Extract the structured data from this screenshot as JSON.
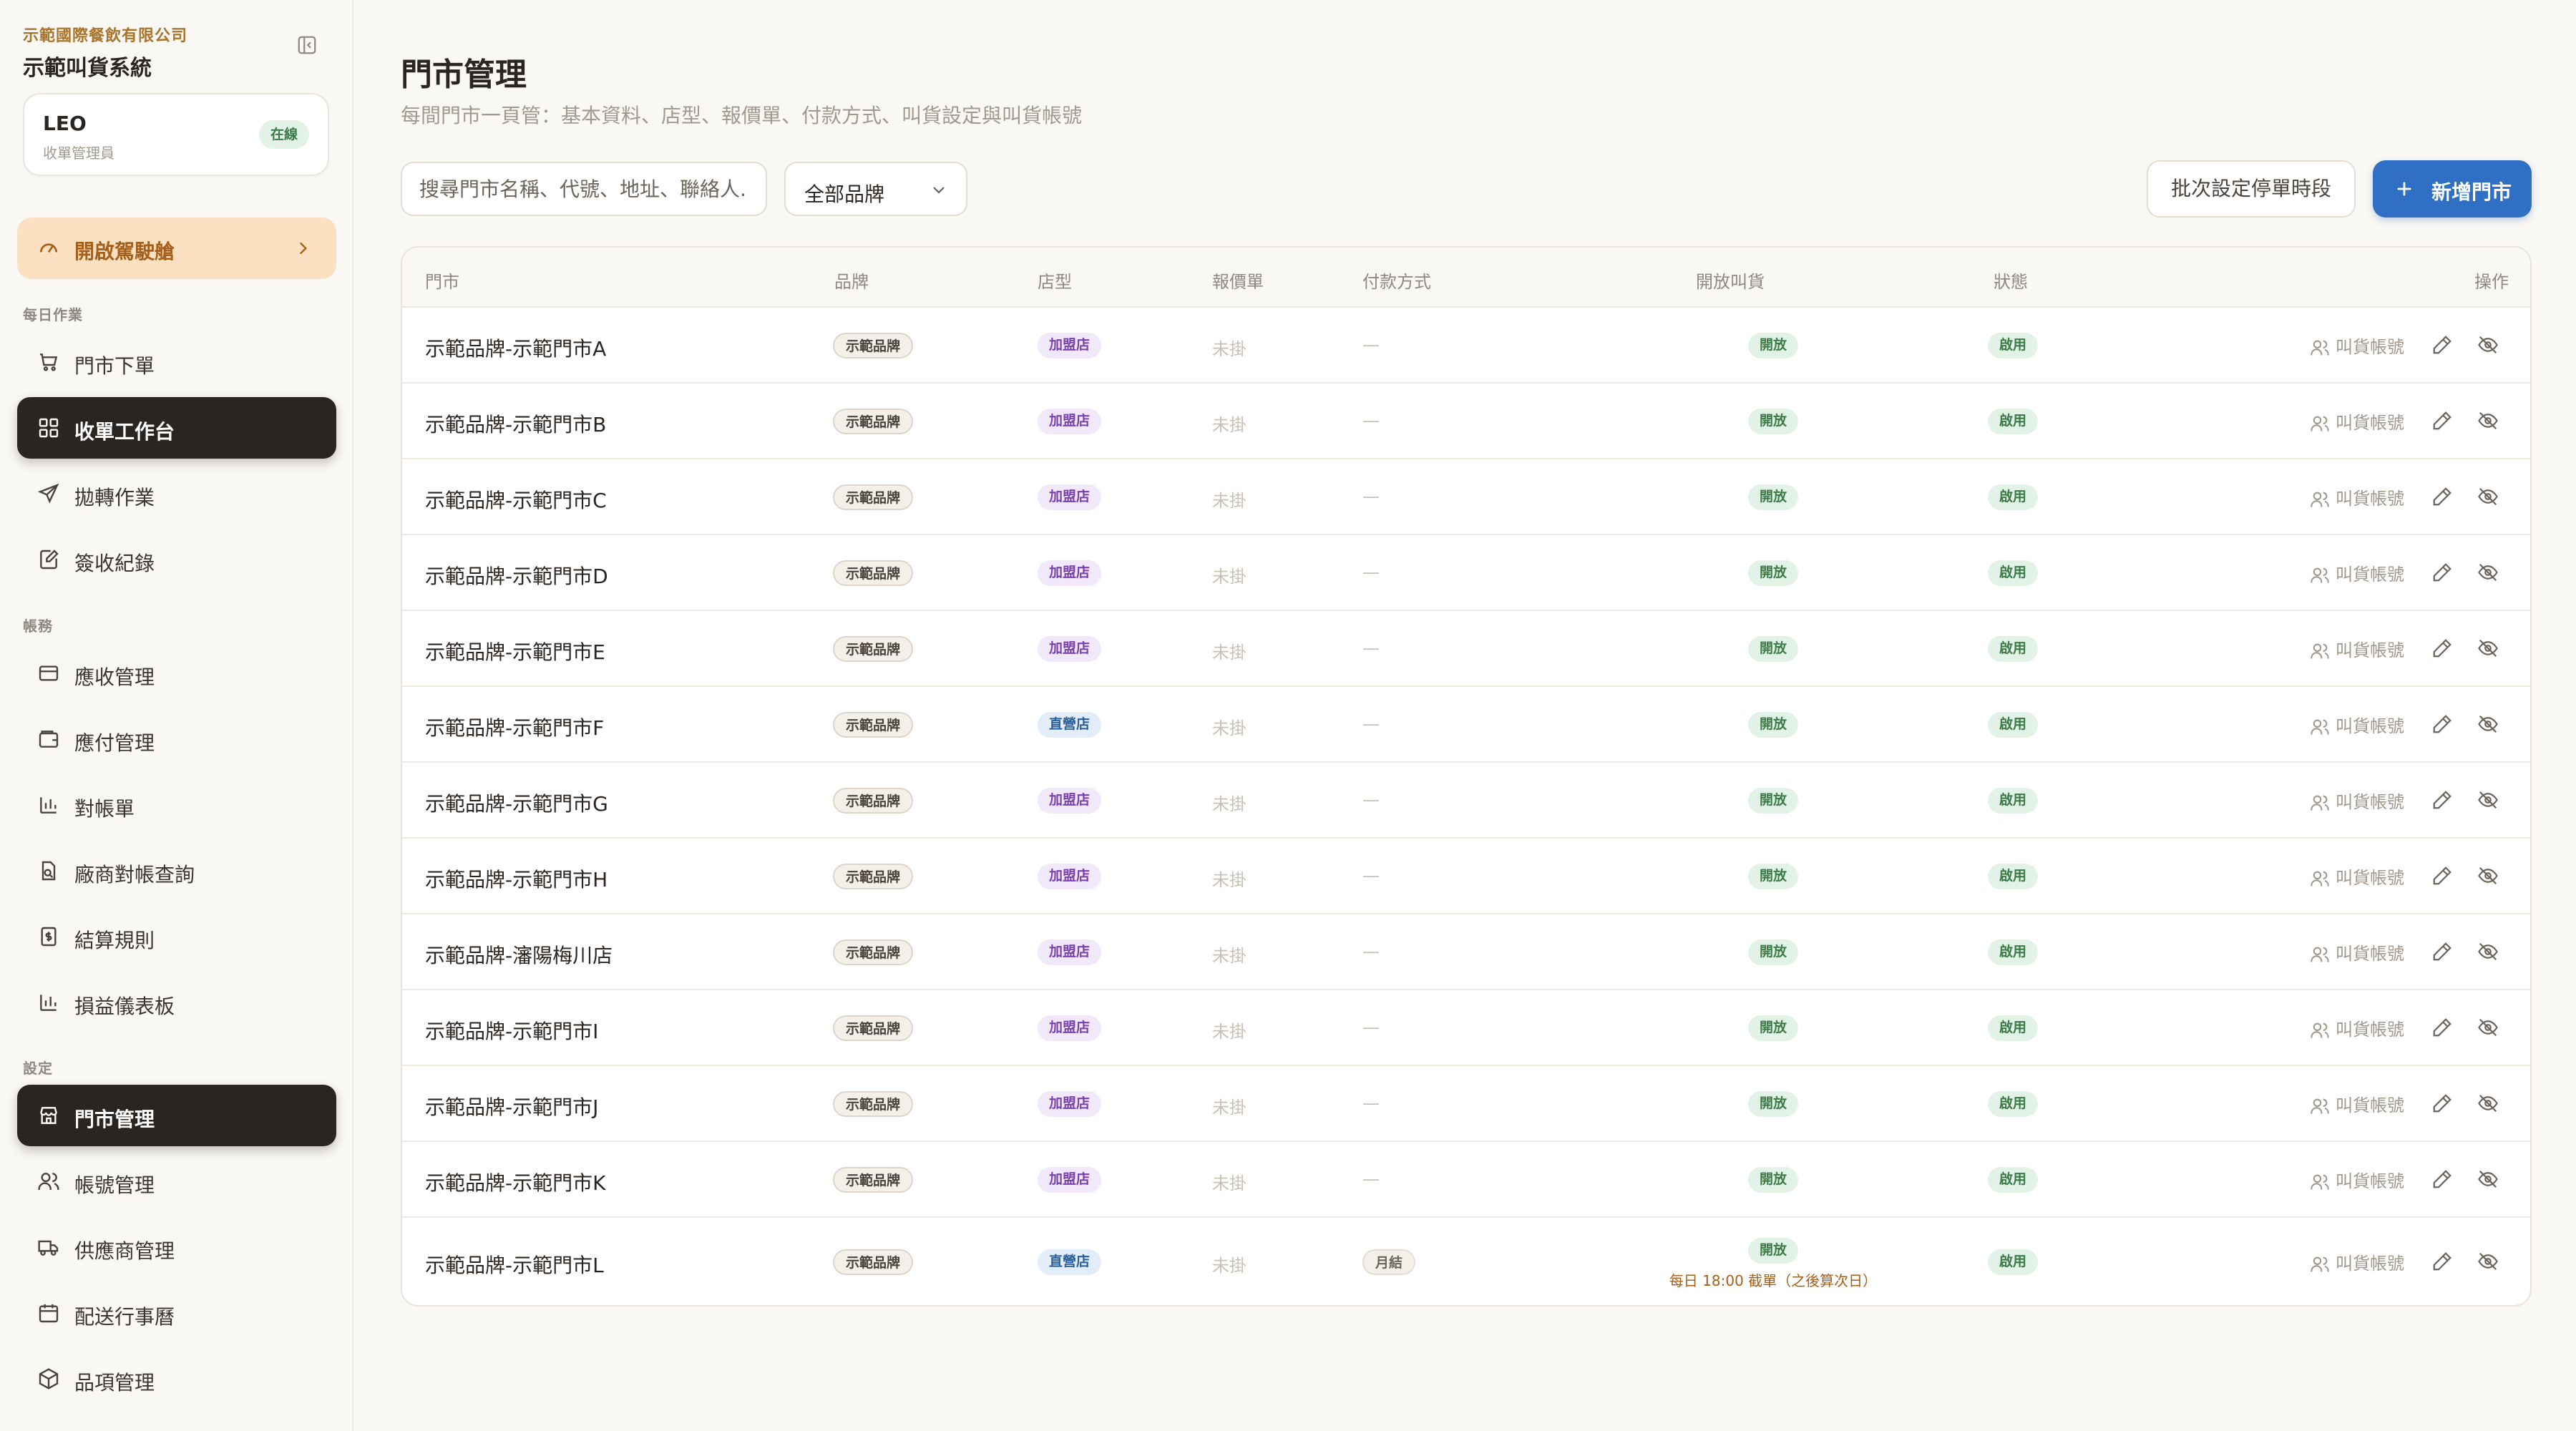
{
  "sidebar": {
    "company": "示範國際餐飲有限公司",
    "system": "示範叫貨系統",
    "user": {
      "name": "LEO",
      "role": "收單管理員",
      "status": "在線"
    },
    "cockpit": "開啟駕駛艙",
    "sections": {
      "daily": "每日作業",
      "accounts": "帳務",
      "settings": "設定"
    },
    "items": [
      {
        "label": "門市下單",
        "icon": "cart-icon"
      },
      {
        "label": "收單工作台",
        "icon": "grid-icon"
      },
      {
        "label": "拋轉作業",
        "icon": "send-icon"
      },
      {
        "label": "簽收紀錄",
        "icon": "sign-icon"
      },
      {
        "label": "應收管理",
        "icon": "card-icon"
      },
      {
        "label": "應付管理",
        "icon": "wallet-icon"
      },
      {
        "label": "對帳單",
        "icon": "bar-chart-icon"
      },
      {
        "label": "廠商對帳查詢",
        "icon": "file-search-icon"
      },
      {
        "label": "結算規則",
        "icon": "dollar-doc-icon"
      },
      {
        "label": "損益儀表板",
        "icon": "bar-chart-icon"
      },
      {
        "label": "門市管理",
        "icon": "store-icon"
      },
      {
        "label": "帳號管理",
        "icon": "users-icon"
      },
      {
        "label": "供應商管理",
        "icon": "truck-icon"
      },
      {
        "label": "配送行事曆",
        "icon": "calendar-icon"
      },
      {
        "label": "品項管理",
        "icon": "box-icon"
      }
    ]
  },
  "header": {
    "title": "門市管理",
    "subtitle": "每間門市一頁管：基本資料、店型、報價單、付款方式、叫貨設定與叫貨帳號"
  },
  "toolbar": {
    "search_placeholder": "搜尋門市名稱、代號、地址、聯絡人...",
    "brand_filter": "全部品牌",
    "batch_label": "批次設定停單時段",
    "add_label": "新增門市"
  },
  "table": {
    "columns": [
      "門市",
      "品牌",
      "店型",
      "報價單",
      "付款方式",
      "開放叫貨",
      "狀態",
      "操作"
    ],
    "account_link": "叫貨帳號",
    "rows": [
      {
        "store": "示範品牌-示範門市A",
        "brand": "示範品牌",
        "type": "加盟店",
        "quote": "未掛",
        "payment": "—",
        "ordering": "開放",
        "cutoff": "",
        "status": "啟用"
      },
      {
        "store": "示範品牌-示範門市B",
        "brand": "示範品牌",
        "type": "加盟店",
        "quote": "未掛",
        "payment": "—",
        "ordering": "開放",
        "cutoff": "",
        "status": "啟用"
      },
      {
        "store": "示範品牌-示範門市C",
        "brand": "示範品牌",
        "type": "加盟店",
        "quote": "未掛",
        "payment": "—",
        "ordering": "開放",
        "cutoff": "",
        "status": "啟用"
      },
      {
        "store": "示範品牌-示範門市D",
        "brand": "示範品牌",
        "type": "加盟店",
        "quote": "未掛",
        "payment": "—",
        "ordering": "開放",
        "cutoff": "",
        "status": "啟用"
      },
      {
        "store": "示範品牌-示範門市E",
        "brand": "示範品牌",
        "type": "加盟店",
        "quote": "未掛",
        "payment": "—",
        "ordering": "開放",
        "cutoff": "",
        "status": "啟用"
      },
      {
        "store": "示範品牌-示範門市F",
        "brand": "示範品牌",
        "type": "直營店",
        "quote": "未掛",
        "payment": "—",
        "ordering": "開放",
        "cutoff": "",
        "status": "啟用"
      },
      {
        "store": "示範品牌-示範門市G",
        "brand": "示範品牌",
        "type": "加盟店",
        "quote": "未掛",
        "payment": "—",
        "ordering": "開放",
        "cutoff": "",
        "status": "啟用"
      },
      {
        "store": "示範品牌-示範門市H",
        "brand": "示範品牌",
        "type": "加盟店",
        "quote": "未掛",
        "payment": "—",
        "ordering": "開放",
        "cutoff": "",
        "status": "啟用"
      },
      {
        "store": "示範品牌-瀋陽梅川店",
        "brand": "示範品牌",
        "type": "加盟店",
        "quote": "未掛",
        "payment": "—",
        "ordering": "開放",
        "cutoff": "",
        "status": "啟用"
      },
      {
        "store": "示範品牌-示範門市I",
        "brand": "示範品牌",
        "type": "加盟店",
        "quote": "未掛",
        "payment": "—",
        "ordering": "開放",
        "cutoff": "",
        "status": "啟用"
      },
      {
        "store": "示範品牌-示範門市J",
        "brand": "示範品牌",
        "type": "加盟店",
        "quote": "未掛",
        "payment": "—",
        "ordering": "開放",
        "cutoff": "",
        "status": "啟用"
      },
      {
        "store": "示範品牌-示範門市K",
        "brand": "示範品牌",
        "type": "加盟店",
        "quote": "未掛",
        "payment": "—",
        "ordering": "開放",
        "cutoff": "",
        "status": "啟用"
      },
      {
        "store": "示範品牌-示範門市L",
        "brand": "示範品牌",
        "type": "直營店",
        "quote": "未掛",
        "payment": "月結",
        "ordering": "開放",
        "cutoff": "每日 18:00 截單（之後算次日）",
        "status": "啟用"
      }
    ]
  },
  "colors": {
    "accent": "#2f6fc4",
    "active_nav": "#2b2522",
    "cockpit_bg": "#fbe1c1",
    "brand_text": "#a9742b"
  }
}
